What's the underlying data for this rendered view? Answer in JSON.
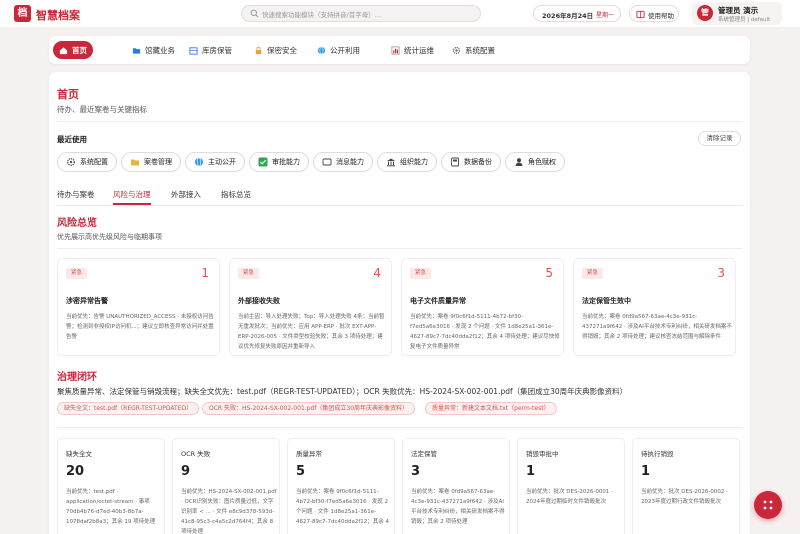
{
  "app": {
    "logo_glyph": "档",
    "name": "智慧档案"
  },
  "search": {
    "placeholder": "快速搜索功能模块（支持拼音/首字母）..."
  },
  "header": {
    "date": "2026年8月24日",
    "weekday": "星期一",
    "help_label": "使用帮助"
  },
  "user": {
    "avatar_glyph": "管",
    "name": "管理员 演示",
    "role": "系统管理员 | default"
  },
  "nav": [
    {
      "label": "首页",
      "icon": "home-icon",
      "active": true
    },
    {
      "label": "馆藏业务",
      "icon": "folder-icon"
    },
    {
      "label": "库房保管",
      "icon": "warehouse-icon"
    },
    {
      "label": "保密安全",
      "icon": "lock-icon"
    },
    {
      "label": "公开利用",
      "icon": "globe-icon"
    },
    {
      "label": "统计运维",
      "icon": "chart-icon"
    },
    {
      "label": "系统配置",
      "icon": "gear-icon"
    }
  ],
  "page": {
    "title": "首页",
    "subtitle": "待办、最近案卷与关键指标"
  },
  "recent": {
    "label": "最近使用",
    "clear_label": "清除记录",
    "items": [
      {
        "label": "系统配置",
        "icon": "gear-icon"
      },
      {
        "label": "案卷管理",
        "icon": "folder-icon"
      },
      {
        "label": "主动公开",
        "icon": "globe-icon"
      },
      {
        "label": "审批能力",
        "icon": "check-icon"
      },
      {
        "label": "消息能力",
        "icon": "message-icon"
      },
      {
        "label": "组织能力",
        "icon": "org-icon"
      },
      {
        "label": "数据备份",
        "icon": "backup-icon"
      },
      {
        "label": "角色赋权",
        "icon": "user-role-icon"
      }
    ]
  },
  "tabs": [
    {
      "label": "待办与案卷"
    },
    {
      "label": "风险与治理",
      "active": true
    },
    {
      "label": "外部接入"
    },
    {
      "label": "指标总览"
    }
  ],
  "risk": {
    "title": "风险总览",
    "subtitle": "优先展示高优先级风险与临期事项",
    "cards": [
      {
        "badge": "紧急",
        "count": "1",
        "title": "涉密异常告警",
        "desc": "当前优先：告警 UNAUTHORIZED_ACCESS · 未授权访问告警；检测到非授权IP访问机...；建议立即核查异常访问并处置告警"
      },
      {
        "badge": "紧急",
        "count": "4",
        "title": "外部接收失败",
        "desc": "当前主因：导入处理失败；Top：导入处理失败 4条；当前暂无重发批次；当前优先：应用 APP-ERP · 批次 EXT-APP-ERP-2026-005 · 文件类型校验失败；其余 3 项待处理；建议优先修复失败原因并重新导入"
      },
      {
        "badge": "紧急",
        "count": "5",
        "title": "电子文件质量异常",
        "desc": "当前优先：案卷 9f0c6f1d-5111-4b72-bf30-f7ed5a6e3016 · 发现 2 个问题 · 文件 1d8e25a1-361e-4627-89c7-7dc40dda2f12；其余 4 项待处理；建议尽快修复电子文件质量异常"
      },
      {
        "badge": "紧急",
        "count": "3",
        "title": "法定保管生效中",
        "desc": "当前优先：案卷 0fd9a567-63ae-4c3e-931c-437271a9f642 · 涉及AI平台技术专利纠纷，相关研发档案不得销毁；其余 2 项待处理；建议核查冻结范围与解除条件"
      }
    ]
  },
  "governance": {
    "title": "治理闭环",
    "subtitle": "聚焦质量异常、法定保管与销毁流程；缺失全文优先：test.pdf（REGR-TEST-UPDATED）；OCR 失败优先：HS-2024-SX-002-001.pdf（集团成立30周年庆典影像资料）",
    "tags": [
      {
        "label": "缺失全文：test.pdf（REGR-TEST-UPDATED）"
      },
      {
        "label": "OCR 失败：HS-2024-SX-002-001.pdf（集团成立30周年庆典影像资料）"
      },
      {
        "label": "质量异常：新建文本文档.txt（perm-test）"
      }
    ],
    "stats": [
      {
        "label": "缺失全文",
        "value": "20",
        "desc": "当前优先：test.pdf · application/octet-stream · 事项 70db4b76-d7ed-40b3-8b7a-1078daf2b8a3；其余 19 项待处理"
      },
      {
        "label": "OCR 失败",
        "value": "9",
        "desc": "当前优先：HS-2024-SX-002-001.pdf · OCR识别失败：图片质量过低，文字识别率 < ... · 文件 e8c9d378-593d-41c8-95c3-c4a5c2d764f4；其余 8 项待处理"
      },
      {
        "label": "质量异常",
        "value": "5",
        "desc": "当前优先：案卷 9f0c6f1d-5111-4b72-bf30-f7ed5a6e3016 · 发现 2 个问题 · 文件 1d8e25a1-361e-4627-89c7-7dc40dda2f12；其余 4"
      },
      {
        "label": "法定保管",
        "value": "3",
        "desc": "当前优先：案卷 0fd9a567-63ae-4c3e-931c-437271a9f642 · 涉及AI平台技术专利纠纷，相关研发档案不得销毁；其余 2 项待处理"
      },
      {
        "label": "销毁审批中",
        "value": "1",
        "desc": "当前优先：批次 DES-2026-0001 · 2024年度过期临时文件销毁批次"
      },
      {
        "label": "待执行销毁",
        "value": "1",
        "desc": "当前优先：批次 DES-2026-0002 · 2023年度过期行政文件销毁批次"
      }
    ]
  },
  "colors": {
    "brand": "#c8283a",
    "urgent": "#e0554b"
  }
}
